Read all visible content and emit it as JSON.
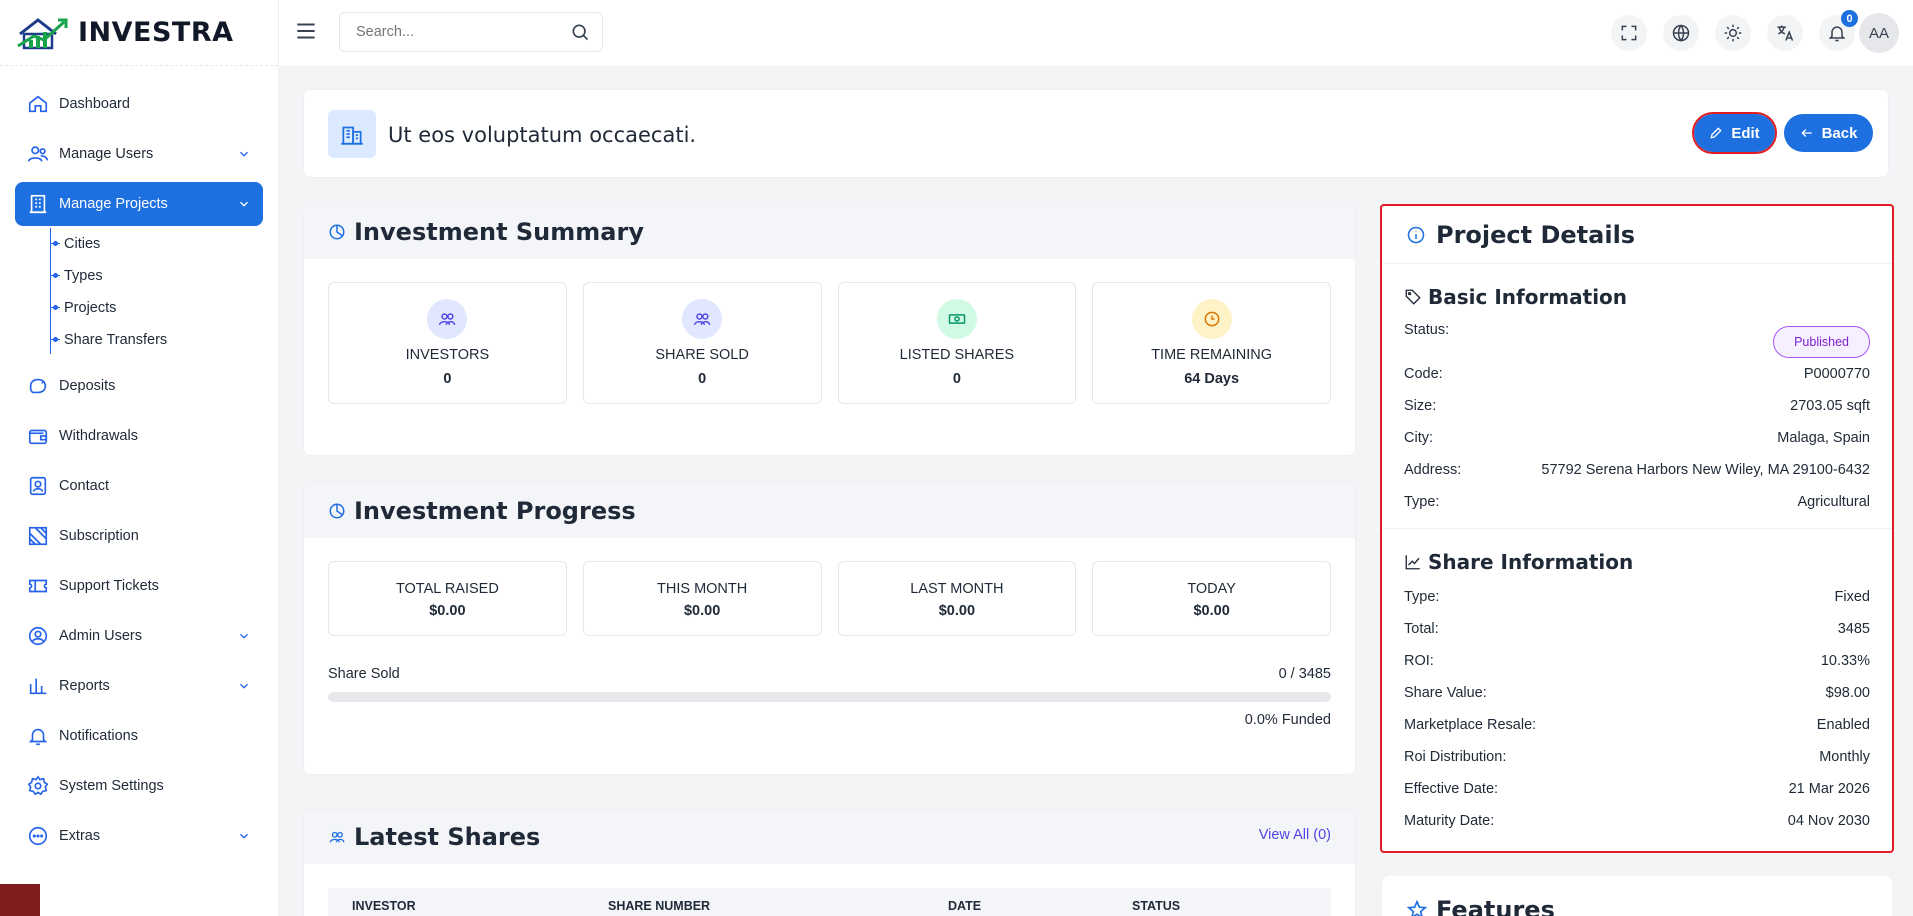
{
  "brand": {
    "name": "INVESTRA"
  },
  "sidebar": {
    "items": [
      {
        "label": "Dashboard",
        "icon": "home-icon"
      },
      {
        "label": "Manage Users",
        "icon": "users-icon"
      },
      {
        "label": "Manage Projects",
        "icon": "building-icon"
      },
      {
        "label": "Deposits",
        "icon": "deposit-icon"
      },
      {
        "label": "Withdrawals",
        "icon": "wallet-icon"
      },
      {
        "label": "Contact",
        "icon": "contact-icon"
      },
      {
        "label": "Subscription",
        "icon": "subscription-icon"
      },
      {
        "label": "Support Tickets",
        "icon": "ticket-icon"
      },
      {
        "label": "Admin Users",
        "icon": "admin-icon"
      },
      {
        "label": "Reports",
        "icon": "chart-icon"
      },
      {
        "label": "Notifications",
        "icon": "bell-icon"
      },
      {
        "label": "System Settings",
        "icon": "gear-icon"
      },
      {
        "label": "Extras",
        "icon": "dots-icon"
      }
    ],
    "sub_items": [
      {
        "label": "Cities"
      },
      {
        "label": "Types"
      },
      {
        "label": "Projects"
      },
      {
        "label": "Share Transfers"
      }
    ]
  },
  "topbar": {
    "search_placeholder": "Search...",
    "notification_count": "0",
    "avatar_initials": "AA"
  },
  "header": {
    "title": "Ut eos voluptatum occaecati.",
    "edit_label": "Edit",
    "back_label": "Back"
  },
  "summary": {
    "title": "Investment Summary",
    "stats": [
      {
        "label": "INVESTORS",
        "value": "0"
      },
      {
        "label": "SHARE SOLD",
        "value": "0"
      },
      {
        "label": "LISTED SHARES",
        "value": "0"
      },
      {
        "label": "TIME REMAINING",
        "value": "64 Days"
      }
    ]
  },
  "progress": {
    "title": "Investment Progress",
    "stats": [
      {
        "label": "TOTAL RAISED",
        "value": "$0.00"
      },
      {
        "label": "THIS MONTH",
        "value": "$0.00"
      },
      {
        "label": "LAST MONTH",
        "value": "$0.00"
      },
      {
        "label": "TODAY",
        "value": "$0.00"
      }
    ],
    "share_sold_label": "Share Sold",
    "share_sold_count": "0 / 3485",
    "funded_text": "0.0% Funded",
    "funded_fraction": 0.0
  },
  "latest_shares": {
    "title": "Latest Shares",
    "view_all": "View All (0)",
    "columns": [
      "INVESTOR",
      "SHARE NUMBER",
      "DATE",
      "STATUS"
    ]
  },
  "details": {
    "title": "Project Details",
    "basic_title": "Basic Information",
    "status_label": "Status:",
    "status_value": "Published",
    "basic_rows": [
      {
        "label": "Code:",
        "value": "P0000770"
      },
      {
        "label": "Size:",
        "value": "2703.05 sqft"
      },
      {
        "label": "City:",
        "value": "Malaga, Spain"
      },
      {
        "label": "Address:",
        "value": "57792 Serena Harbors New Wiley, MA 29100-6432"
      },
      {
        "label": "Type:",
        "value": "Agricultural"
      }
    ],
    "share_title": "Share Information",
    "share_rows": [
      {
        "label": "Type:",
        "value": "Fixed"
      },
      {
        "label": "Total:",
        "value": "3485"
      },
      {
        "label": "ROI:",
        "value": "10.33%"
      },
      {
        "label": "Share Value:",
        "value": "$98.00"
      },
      {
        "label": "Marketplace Resale:",
        "value": "Enabled"
      },
      {
        "label": "Roi Distribution:",
        "value": "Monthly"
      },
      {
        "label": "Effective Date:",
        "value": "21 Mar 2026"
      },
      {
        "label": "Maturity Date:",
        "value": "04 Nov 2030"
      }
    ]
  },
  "features": {
    "title": "Features"
  },
  "colors": {
    "accent": "#1e6fe0",
    "highlight_outline": "#e11d21",
    "status_published": "#7e22ce"
  }
}
